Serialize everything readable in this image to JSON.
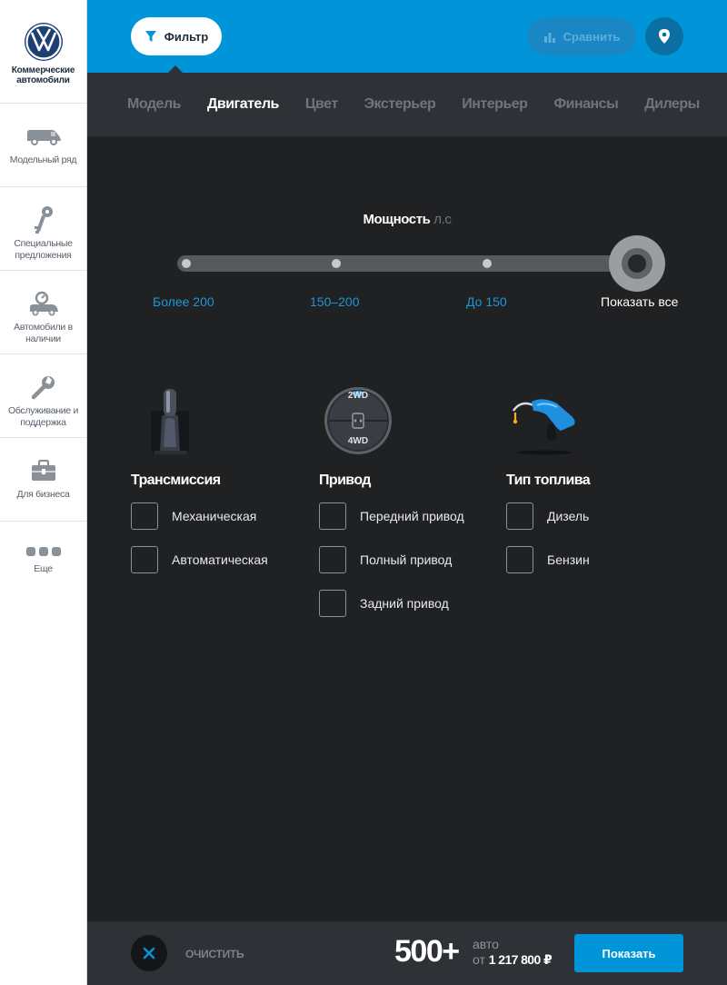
{
  "sidebar": {
    "brand_caption": "Коммерческие автомобили",
    "items": [
      {
        "label": "Модельный ряд",
        "icon": "van-icon"
      },
      {
        "label": "Специальные предложения",
        "icon": "keys-icon"
      },
      {
        "label": "Автомобили в наличии",
        "icon": "car-key-icon"
      },
      {
        "label": "Обслуживание и поддержка",
        "icon": "wrench-icon"
      },
      {
        "label": "Для бизнеса",
        "icon": "briefcase-icon"
      },
      {
        "label": "Еще",
        "icon": "more-dots-icon"
      }
    ]
  },
  "topbar": {
    "filter_label": "Фильтр",
    "compare_label": "Сравнить",
    "brand_color": "#0095d9"
  },
  "tabs": [
    {
      "label": "Модель",
      "active": false
    },
    {
      "label": "Двигатель",
      "active": true
    },
    {
      "label": "Цвет",
      "active": false
    },
    {
      "label": "Экстерьер",
      "active": false
    },
    {
      "label": "Интерьер",
      "active": false
    },
    {
      "label": "Финансы",
      "active": false
    },
    {
      "label": "Дилеры",
      "active": false
    }
  ],
  "power": {
    "title": "Мощность",
    "unit": "л.с",
    "options": [
      "Более 200",
      "150–200",
      "До 150",
      "Показать все"
    ],
    "selected": "Показать все"
  },
  "groups": {
    "transmission": {
      "title": "Трансмиссия",
      "options": [
        "Механическая",
        "Автоматическая"
      ]
    },
    "drive": {
      "title": "Привод",
      "options": [
        "Передний привод",
        "Полный привод",
        "Задний привод"
      ],
      "dial_top": "2WD",
      "dial_bottom": "4WD"
    },
    "fuel": {
      "title": "Тип топлива",
      "options": [
        "Дизель",
        "Бензин"
      ]
    }
  },
  "bottombar": {
    "clear_label": "ОЧИСТИТЬ",
    "count": "500+",
    "count_unit": "авто",
    "price_prefix": "от",
    "price": "1 217 800 ₽",
    "show_label": "Показать"
  }
}
